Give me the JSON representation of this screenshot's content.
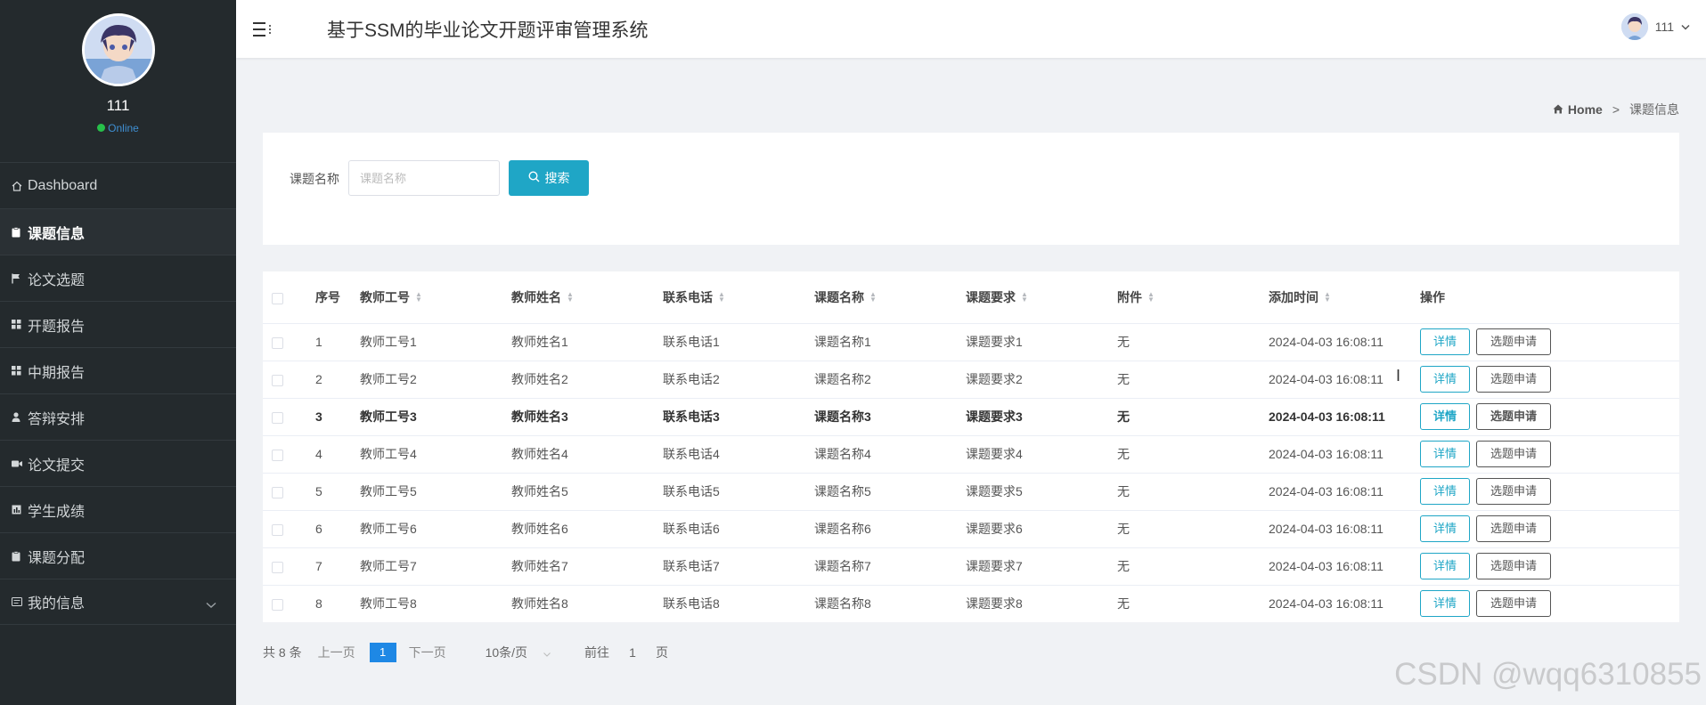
{
  "sidebar": {
    "profile_name": "111",
    "status": "Online",
    "items": [
      {
        "label": "Dashboard",
        "icon": "home-icon"
      },
      {
        "label": "课题信息",
        "icon": "clipboard-icon"
      },
      {
        "label": "论文选题",
        "icon": "flag-icon"
      },
      {
        "label": "开题报告",
        "icon": "grid-icon"
      },
      {
        "label": "中期报告",
        "icon": "grid-icon"
      },
      {
        "label": "答辩安排",
        "icon": "user-icon"
      },
      {
        "label": "论文提交",
        "icon": "camera-icon"
      },
      {
        "label": "学生成绩",
        "icon": "chart-icon"
      },
      {
        "label": "课题分配",
        "icon": "clipboard-icon"
      },
      {
        "label": "我的信息",
        "icon": "id-card-icon"
      }
    ]
  },
  "header": {
    "title": "基于SSM的毕业论文开题评审管理系统",
    "user": "111"
  },
  "breadcrumb": {
    "home": "Home",
    "sep": ">",
    "current": "课题信息"
  },
  "search": {
    "label": "课题名称",
    "placeholder": "课题名称",
    "value": "",
    "button": "搜索"
  },
  "table": {
    "columns": [
      "序号",
      "教师工号",
      "教师姓名",
      "联系电话",
      "课题名称",
      "课题要求",
      "附件",
      "添加时间",
      "操作"
    ],
    "rows": [
      [
        "1",
        "教师工号1",
        "教师姓名1",
        "联系电话1",
        "课题名称1",
        "课题要求1",
        "无",
        "2024-04-03 16:08:11"
      ],
      [
        "2",
        "教师工号2",
        "教师姓名2",
        "联系电话2",
        "课题名称2",
        "课题要求2",
        "无",
        "2024-04-03 16:08:11"
      ],
      [
        "3",
        "教师工号3",
        "教师姓名3",
        "联系电话3",
        "课题名称3",
        "课题要求3",
        "无",
        "2024-04-03 16:08:11"
      ],
      [
        "4",
        "教师工号4",
        "教师姓名4",
        "联系电话4",
        "课题名称4",
        "课题要求4",
        "无",
        "2024-04-03 16:08:11"
      ],
      [
        "5",
        "教师工号5",
        "教师姓名5",
        "联系电话5",
        "课题名称5",
        "课题要求5",
        "无",
        "2024-04-03 16:08:11"
      ],
      [
        "6",
        "教师工号6",
        "教师姓名6",
        "联系电话6",
        "课题名称6",
        "课题要求6",
        "无",
        "2024-04-03 16:08:11"
      ],
      [
        "7",
        "教师工号7",
        "教师姓名7",
        "联系电话7",
        "课题名称7",
        "课题要求7",
        "无",
        "2024-04-03 16:08:11"
      ],
      [
        "8",
        "教师工号8",
        "教师姓名8",
        "联系电话8",
        "课题名称8",
        "课题要求8",
        "无",
        "2024-04-03 16:08:11"
      ]
    ],
    "detail_label": "详情",
    "apply_label": "选题申请"
  },
  "pagination": {
    "total": "共 8 条",
    "prev": "上一页",
    "current_page": "1",
    "next": "下一页",
    "page_size": "10条/页",
    "goto_label": "前往",
    "goto_value": "1",
    "goto_unit": "页"
  },
  "watermark": "CSDN @wqq6310855",
  "colors": {
    "sidebar_bg": "#242a2d",
    "accent": "#1fa6c6",
    "page_active": "#1e88e5",
    "online": "#27c04a"
  }
}
